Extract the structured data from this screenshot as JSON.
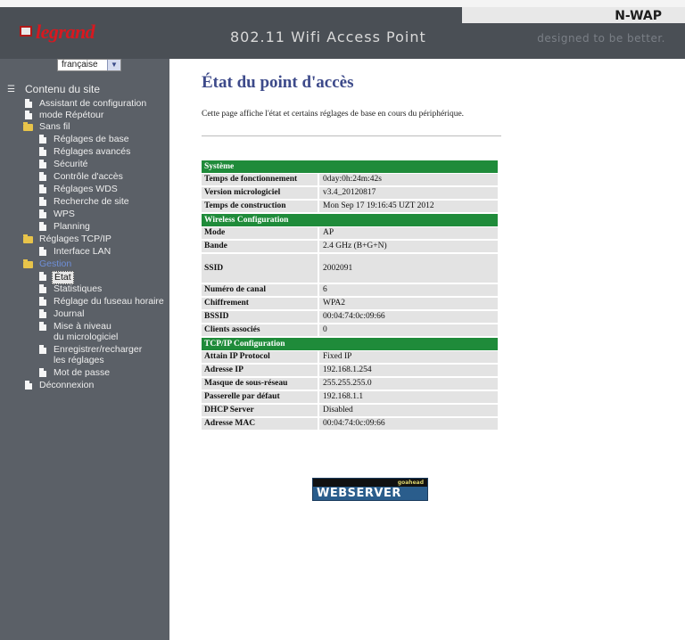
{
  "header": {
    "brand": "legrand",
    "title": "802.11 Wifi Access Point",
    "model": "N-WAP",
    "tagline": "designed to be better."
  },
  "sidebar": {
    "language": "française",
    "items": [
      {
        "label": "Contenu du site",
        "icon": "list-icon"
      },
      {
        "label": "Assistant de configuration",
        "icon": "doc-icon"
      },
      {
        "label": "mode Répétour",
        "icon": "doc-icon"
      },
      {
        "label": "Sans fil",
        "icon": "folder-icon"
      },
      {
        "label": "Réglages de base",
        "icon": "doc-icon"
      },
      {
        "label": "Réglages avancés",
        "icon": "doc-icon"
      },
      {
        "label": "Sécurité",
        "icon": "doc-icon"
      },
      {
        "label": "Contrôle d'accès",
        "icon": "doc-icon"
      },
      {
        "label": "Réglages WDS",
        "icon": "doc-icon"
      },
      {
        "label": "Recherche de site",
        "icon": "doc-icon"
      },
      {
        "label": "WPS",
        "icon": "doc-icon"
      },
      {
        "label": "Planning",
        "icon": "doc-icon"
      },
      {
        "label": "Réglages TCP/IP",
        "icon": "folder-icon"
      },
      {
        "label": "Interface LAN",
        "icon": "doc-icon"
      },
      {
        "label": "Gestion",
        "icon": "folder-icon"
      },
      {
        "label": "État",
        "icon": "doc-icon"
      },
      {
        "label": "Statistiques",
        "icon": "doc-icon"
      },
      {
        "label": "Réglage du fuseau horaire",
        "icon": "doc-icon"
      },
      {
        "label": "Journal",
        "icon": "doc-icon"
      },
      {
        "label": "Mise à niveau",
        "label2": "du micrologiciel",
        "icon": "doc-icon"
      },
      {
        "label": "Enregistrer/recharger",
        "label2": "les réglages",
        "icon": "doc-icon"
      },
      {
        "label": "Mot de passe",
        "icon": "doc-icon"
      },
      {
        "label": "Déconnexion",
        "icon": "doc-icon"
      }
    ]
  },
  "main": {
    "title": "État du point d'accès",
    "description": "Cette page affiche l'état et certains réglages de base en cours du périphérique.",
    "sections": [
      {
        "header": "Système",
        "rows": [
          {
            "label": "Temps de fonctionnement",
            "value": "0day:0h:24m:42s"
          },
          {
            "label": "Version micrologiciel",
            "value": "v3.4_20120817"
          },
          {
            "label": "Temps de construction",
            "value": "Mon Sep 17 19:16:45 UZT 2012"
          }
        ]
      },
      {
        "header": "Wireless Configuration",
        "rows": [
          {
            "label": "Mode",
            "value": "AP"
          },
          {
            "label": "Bande",
            "value": "2.4 GHz (B+G+N)"
          },
          {
            "label": "SSID",
            "value": "2002091"
          },
          {
            "label": "Numéro de canal",
            "value": "6"
          },
          {
            "label": "Chiffrement",
            "value": "WPA2"
          },
          {
            "label": "BSSID",
            "value": "00:04:74:0c:09:66"
          },
          {
            "label": "Clients associés",
            "value": "0"
          }
        ]
      },
      {
        "header": "TCP/IP Configuration",
        "rows": [
          {
            "label": "Attain IP Protocol",
            "value": "Fixed IP"
          },
          {
            "label": "Adresse IP",
            "value": "192.168.1.254"
          },
          {
            "label": "Masque de sous-réseau",
            "value": "255.255.255.0"
          },
          {
            "label": "Passerelle par défaut",
            "value": "192.168.1.1"
          },
          {
            "label": "DHCP Server",
            "value": "Disabled"
          },
          {
            "label": "Adresse MAC",
            "value": "00:04:74:0c:09:66"
          }
        ]
      }
    ],
    "badge": {
      "top": "goahead",
      "main": "WEBSERVER"
    }
  },
  "colors": {
    "section_header": "#1f8b3a",
    "title": "#3d4a8a",
    "sidebar_bg": "#5b6067",
    "header_bg": "#4a4f55",
    "brand": "#d8181f"
  }
}
